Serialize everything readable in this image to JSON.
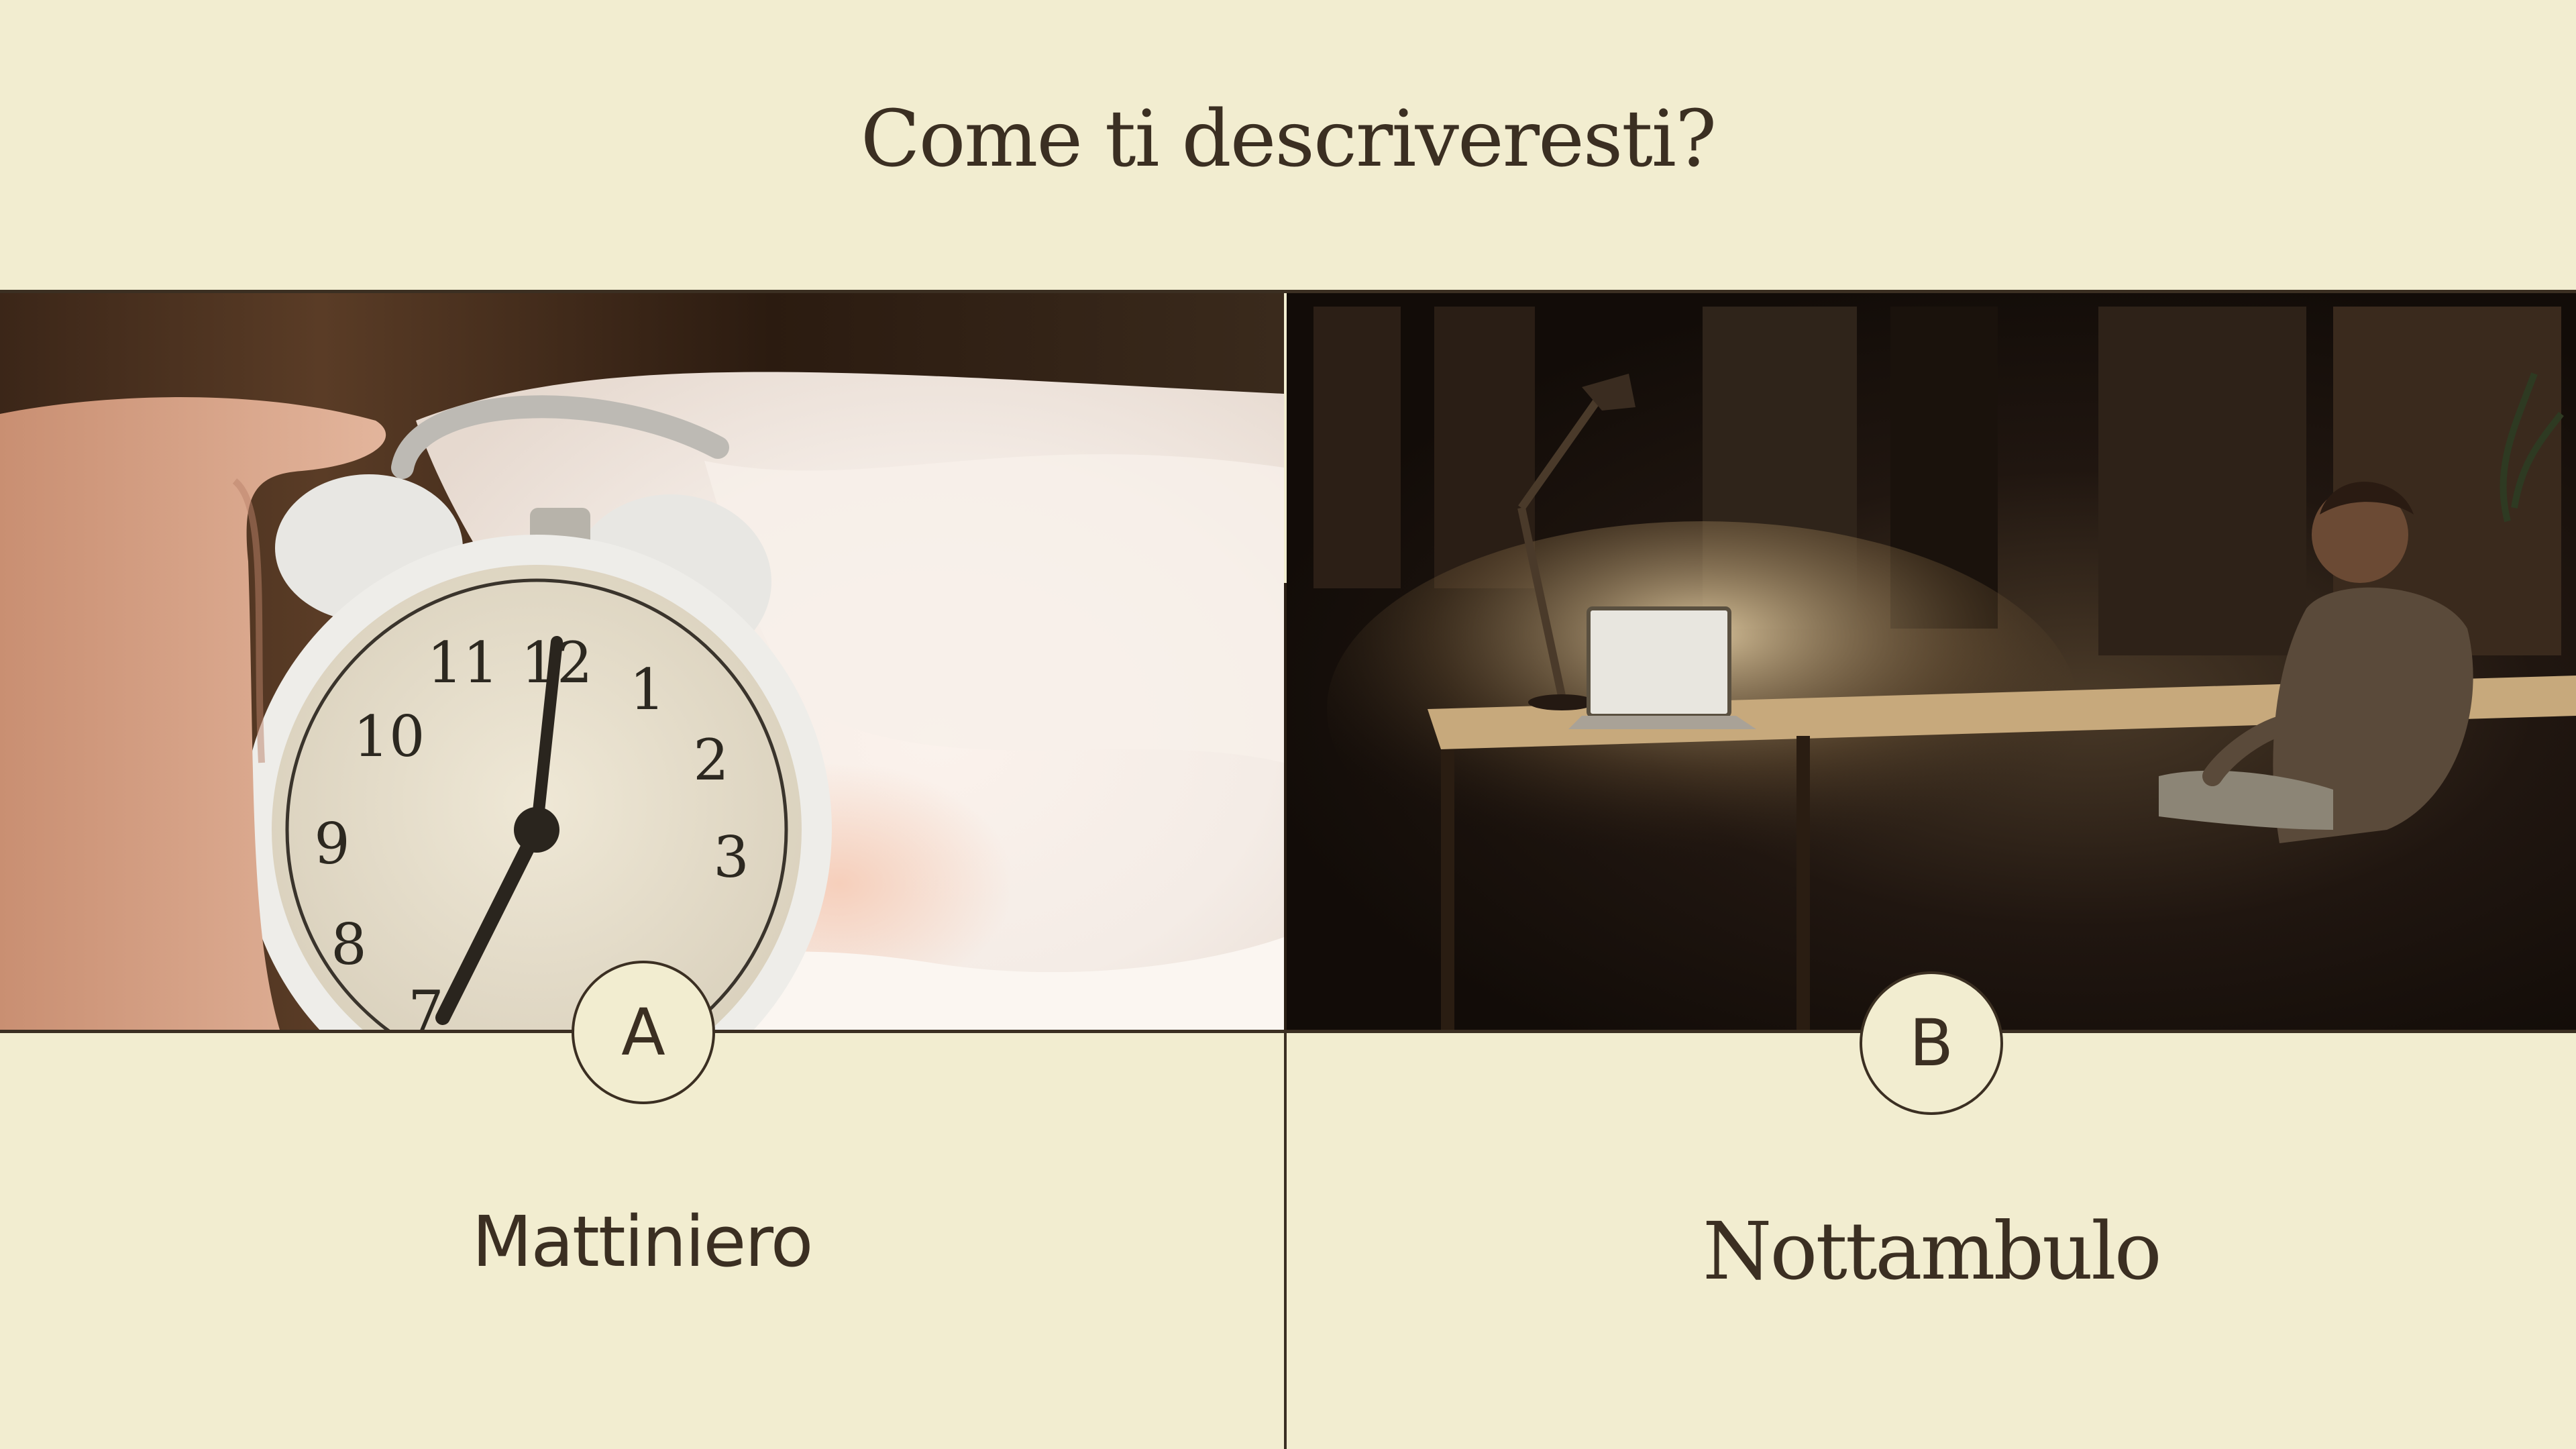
{
  "question": {
    "title": "Come ti descriveresti?"
  },
  "options": [
    {
      "letter": "A",
      "label": "Mattiniero",
      "image_icon": "alarm-clock-photo"
    },
    {
      "letter": "B",
      "label": "Nottambulo",
      "image_icon": "night-desk-laptop-photo"
    }
  ],
  "colors": {
    "background": "#f2edd0",
    "text": "#3b2f22"
  }
}
